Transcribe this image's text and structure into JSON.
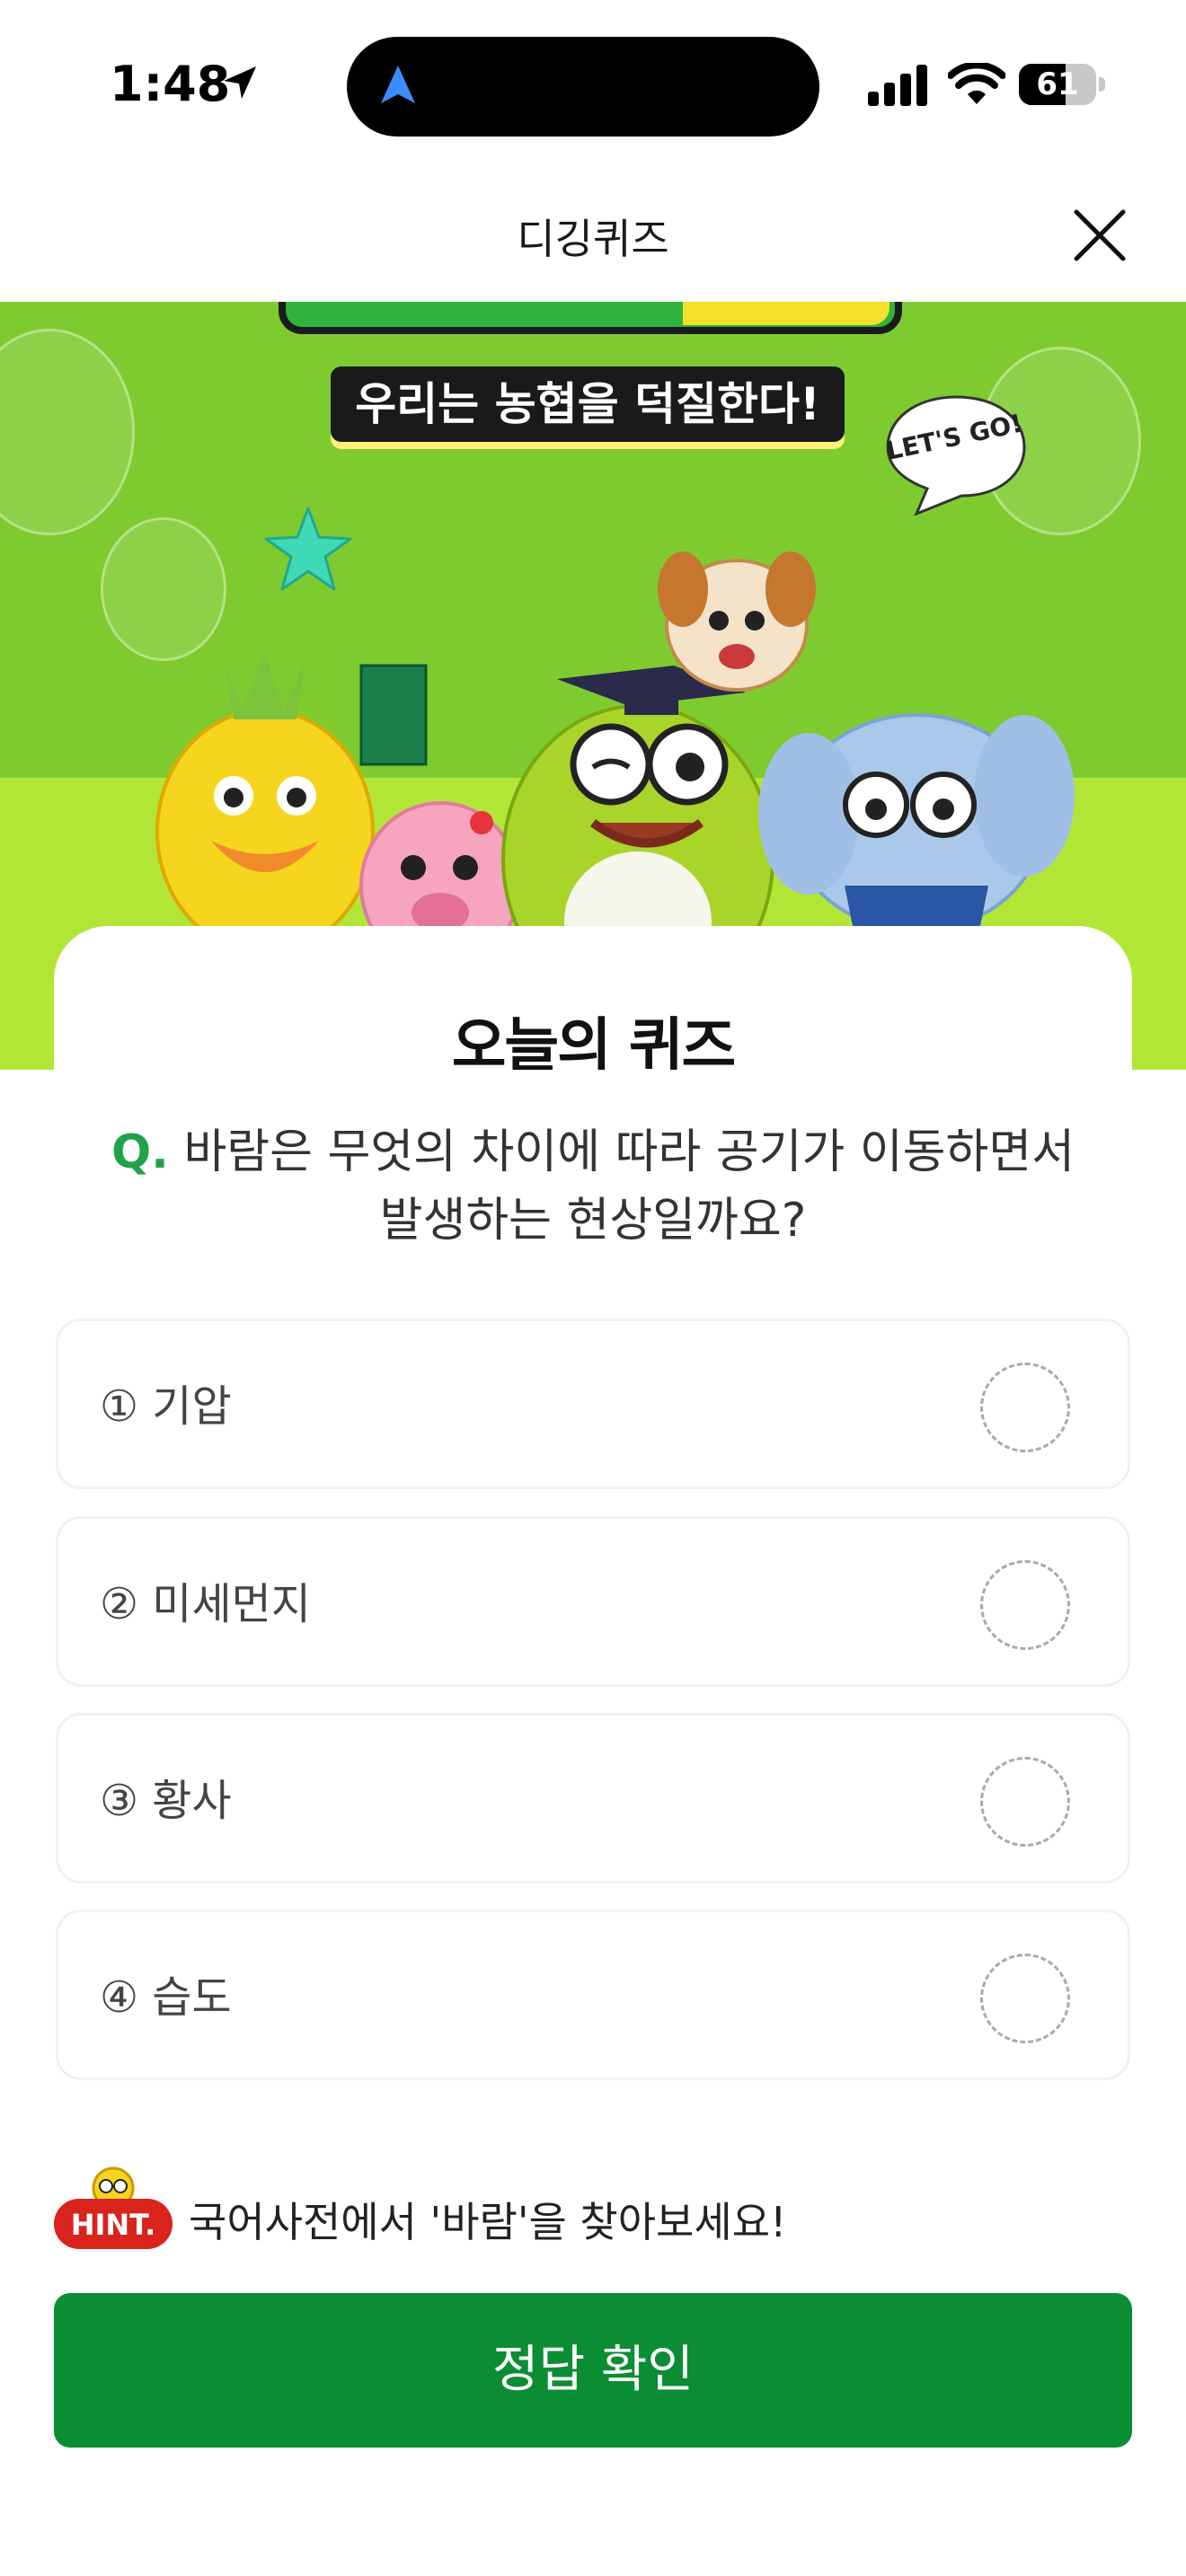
{
  "status_bar": {
    "time": "1:48",
    "battery": "61",
    "battery_level": 0.61
  },
  "header": {
    "title": "디깅퀴즈",
    "close_icon": "close-icon"
  },
  "banner": {
    "slogan": "우리는 농협을 덕질한다!",
    "speech_bubble": "LET'S GO!"
  },
  "quiz": {
    "section_title": "오늘의 퀴즈",
    "question_prefix": "Q.",
    "question": "바람은 무엇의 차이에 따라 공기가 이동하면서 발생하는 현상일까요?",
    "options": [
      {
        "label": "① 기압"
      },
      {
        "label": "② 미세먼지"
      },
      {
        "label": "③ 황사"
      },
      {
        "label": "④ 습도"
      }
    ],
    "hint_badge": "HINT.",
    "hint": "국어사전에서 '바람'을 찾아보세요!",
    "submit_label": "정답 확인"
  },
  "colors": {
    "accent_green": "#0b8d34",
    "question_mark": "#1fa24a",
    "banner_green": "#7ecb2f",
    "hint_red": "#d9231d"
  }
}
